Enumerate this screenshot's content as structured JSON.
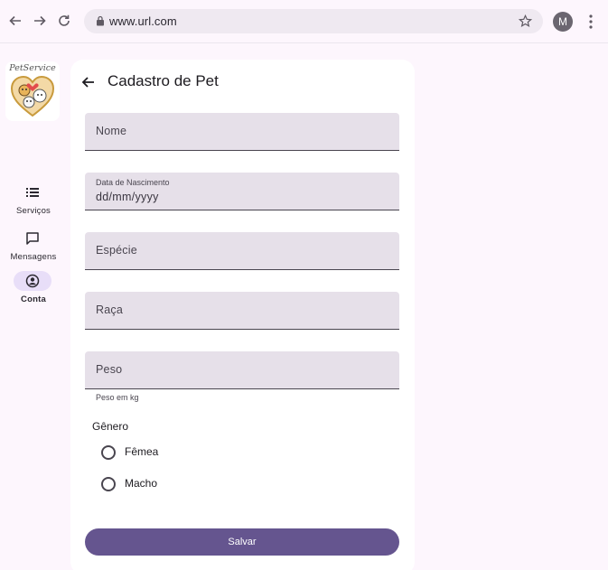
{
  "browser": {
    "url": "www.url.com",
    "profile_initial": "M"
  },
  "brand": {
    "logo_text": "PetService"
  },
  "rail": {
    "items": [
      {
        "label": "Serviços",
        "icon": "list-icon",
        "active": false
      },
      {
        "label": "Mensagens",
        "icon": "chat-icon",
        "active": false
      },
      {
        "label": "Conta",
        "icon": "account-circle-icon",
        "active": true
      }
    ]
  },
  "page": {
    "title": "Cadastro de Pet"
  },
  "form": {
    "nome": {
      "placeholder": "Nome"
    },
    "data_nascimento": {
      "label": "Data de Nascimento",
      "value": "dd/mm/yyyy"
    },
    "especie": {
      "placeholder": "Espécie"
    },
    "raca": {
      "placeholder": "Raça"
    },
    "peso": {
      "placeholder": "Peso",
      "helper": "Peso em kg"
    },
    "genero": {
      "label": "Gênero",
      "options": [
        "Fêmea",
        "Macho"
      ],
      "selected": null
    },
    "save_label": "Salvar"
  },
  "colors": {
    "background": "#fdf6fd",
    "field_bg": "#e6e0e9",
    "primary": "#65558f",
    "active_indicator": "#e8def8"
  }
}
